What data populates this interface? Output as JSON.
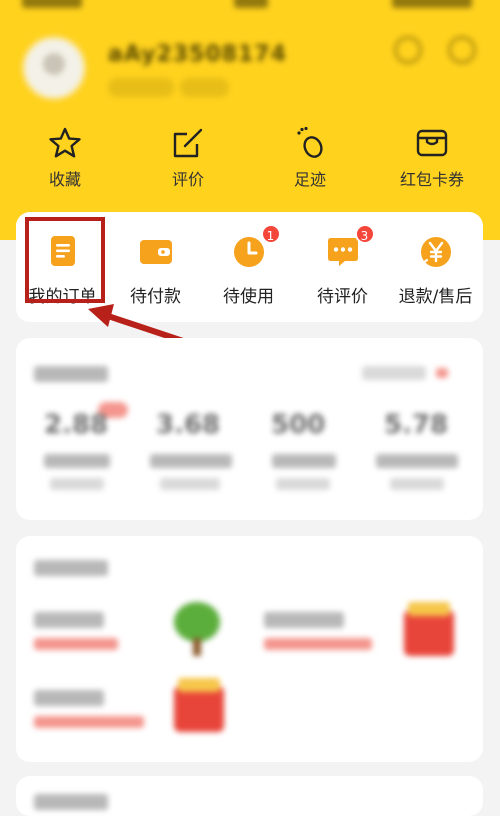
{
  "quick_actions": [
    {
      "label": "收藏",
      "icon": "star-icon"
    },
    {
      "label": "评价",
      "icon": "edit-icon"
    },
    {
      "label": "足迹",
      "icon": "footprint-icon"
    },
    {
      "label": "红包卡券",
      "icon": "wallet-card-icon"
    }
  ],
  "orders": [
    {
      "label": "我的订单",
      "icon": "order-doc-icon",
      "badge": null
    },
    {
      "label": "待付款",
      "icon": "wallet-icon",
      "badge": null
    },
    {
      "label": "待使用",
      "icon": "clock-icon",
      "badge": "1"
    },
    {
      "label": "待评价",
      "icon": "chat-bubble-icon",
      "badge": "3"
    },
    {
      "label": "退款/售后",
      "icon": "refund-yen-icon",
      "badge": null
    }
  ],
  "colors": {
    "header_yellow": "#ffd21e",
    "order_icon_orange": "#f6a21d",
    "badge_red": "#f5463a",
    "annotation_red": "#b8201a"
  }
}
